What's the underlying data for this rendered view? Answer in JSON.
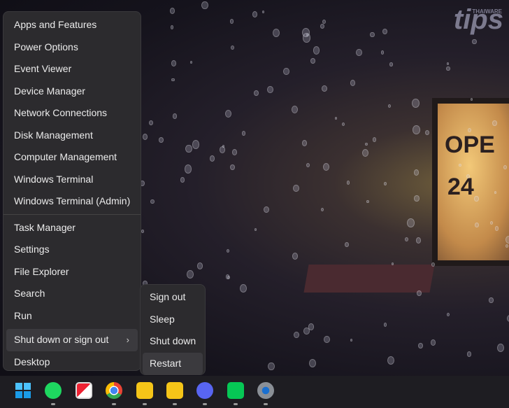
{
  "watermark": {
    "text": "tips",
    "sub": "THAIWARE"
  },
  "background": {
    "sign_line1": "OPE",
    "sign_line2": "24"
  },
  "menu": {
    "items": [
      {
        "label": "Apps and Features"
      },
      {
        "label": "Power Options"
      },
      {
        "label": "Event Viewer"
      },
      {
        "label": "Device Manager"
      },
      {
        "label": "Network Connections"
      },
      {
        "label": "Disk Management"
      },
      {
        "label": "Computer Management"
      },
      {
        "label": "Windows Terminal"
      },
      {
        "label": "Windows Terminal (Admin)"
      },
      {
        "label": "Task Manager"
      },
      {
        "label": "Settings"
      },
      {
        "label": "File Explorer"
      },
      {
        "label": "Search"
      },
      {
        "label": "Run"
      },
      {
        "label": "Shut down or sign out"
      },
      {
        "label": "Desktop"
      }
    ]
  },
  "submenu": {
    "items": [
      {
        "label": "Sign out"
      },
      {
        "label": "Sleep"
      },
      {
        "label": "Shut down"
      },
      {
        "label": "Restart"
      }
    ]
  },
  "taskbar": {
    "apps": [
      "start",
      "spotify",
      "flashget",
      "chrome",
      "ldplayer",
      "ldplayer",
      "discord",
      "line",
      "settings"
    ]
  },
  "colors": {
    "menu_bg": "#2c2b2e",
    "taskbar_bg": "#1e1d22",
    "hover": "#3b3a3e"
  }
}
